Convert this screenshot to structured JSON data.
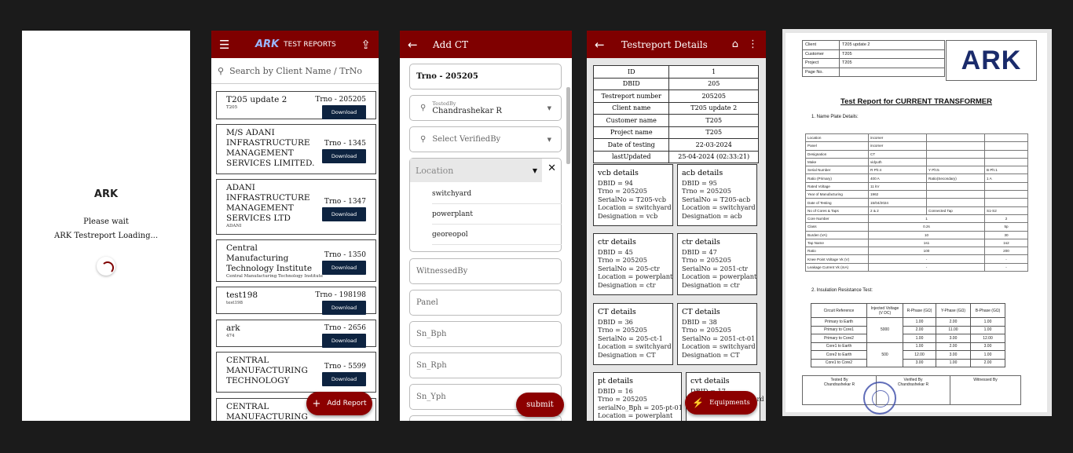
{
  "splash": {
    "logo": "ARK",
    "line1": "Please wait",
    "line2": "ARK Testreport Loading..."
  },
  "reports": {
    "menu_icon": "menu-icon",
    "logo": "ARK",
    "title": "TEST REPORTS",
    "upload_icon": "upload-icon",
    "search_placeholder": "Search by Client Name / TrNo",
    "download": "Download",
    "add": "Add Report",
    "items": [
      {
        "name": "T205 update 2",
        "client": "T205",
        "trno": "Trno - 205205"
      },
      {
        "name": "M/S ADANI INFRASTRUCTURE MANAGEMENT SERVICES LIMITED.",
        "client": "",
        "trno": "Trno - 1345"
      },
      {
        "name": "ADANI INFRASTRUCTURE MANAGEMENT SERVICES LTD",
        "client": "ADANI",
        "trno": "Trno - 1347"
      },
      {
        "name": "Central Manufacturing Technology Institute",
        "client": "Central Manufacturing Technology Institute",
        "trno": "Trno - 1350"
      },
      {
        "name": "test198",
        "client": "test198",
        "trno": "Trno - 198198"
      },
      {
        "name": "ark",
        "client": "474",
        "trno": "Trno - 2656"
      },
      {
        "name": "CENTRAL MANUFACTURING TECHNOLOGY",
        "client": "",
        "trno": "Trno - 5599"
      },
      {
        "name": "CENTRAL MANUFACTURING",
        "client": "",
        "trno": ""
      }
    ]
  },
  "addct": {
    "title": "Add CT",
    "trno": "Trno - 205205",
    "tested_by_label": "TestedBy",
    "tested_by": "Chandrashekar R",
    "verified_placeholder": "Select VerifiedBy",
    "location_placeholder": "Location",
    "locations": [
      "switchyard",
      "powerplant",
      "georeopol"
    ],
    "fields": [
      "WitnessedBy",
      "Panel",
      "Sn_Bph",
      "Sn_Rph",
      "Sn_Yph"
    ],
    "submit": "submit"
  },
  "details": {
    "title": "Testreport Details",
    "equipments": "Equipments",
    "rows": [
      [
        "ID",
        "1"
      ],
      [
        "DBID",
        "205"
      ],
      [
        "Testreport number",
        "205205"
      ],
      [
        "Client name",
        "T205 update 2"
      ],
      [
        "Customer name",
        "T205"
      ],
      [
        "Project name",
        "T205"
      ],
      [
        "Date of testing",
        "22-03-2024"
      ],
      [
        "lastUpdated",
        "25-04-2024 (02:33:21)"
      ]
    ],
    "cards": [
      {
        "title": "vcb details",
        "lines": [
          "DBID = 94",
          "Trno = 205205",
          "SerialNo = T205-vcb",
          "Location = switchyard",
          "Designation = vcb"
        ]
      },
      {
        "title": "acb details",
        "lines": [
          "DBID = 95",
          "Trno = 205205",
          "SerialNo = T205-acb",
          "Location = switchyard",
          "Designation = acb"
        ]
      },
      {
        "title": "ctr details",
        "lines": [
          "DBID = 45",
          "Trno = 205205",
          "SerialNo = 205-ctr",
          "Location = powerplant",
          "Designation = ctr"
        ]
      },
      {
        "title": "ctr details",
        "lines": [
          "DBID = 47",
          "Trno = 205205",
          "SerialNo = 2051-ctr",
          "Location = powerplant",
          "Designation = ctr"
        ]
      },
      {
        "title": "CT details",
        "lines": [
          "DBID = 36",
          "Trno = 205205",
          "SerialNo = 205-ct-1",
          "Location = switchyard",
          "Designation = CT"
        ]
      },
      {
        "title": "CT details",
        "lines": [
          "DBID = 38",
          "Trno = 205205",
          "SerialNo = 2051-ct-01",
          "Location = switchyard",
          "Designation = CT"
        ]
      },
      {
        "title": "pt details",
        "lines": [
          "DBID = 16",
          "Trno = 205205",
          "serialNo_Bph = 205-pt-01",
          "Location = powerplant"
        ]
      },
      {
        "title": "cvt details",
        "lines": [
          "DBID = 17",
          "",
          "",
          "Location = switchyard"
        ]
      }
    ]
  },
  "pdf": {
    "header": [
      [
        "Client",
        "T205 update 2"
      ],
      [
        "Customer",
        "T205"
      ],
      [
        "Project",
        "T205"
      ],
      [
        "Page No.",
        ""
      ]
    ],
    "logo": "ARK",
    "title": "Test Report for CURRENT TRANSFORMER",
    "sec1": "1. Name Plate Details:",
    "sec2": "2. Insulation Resistance Test:",
    "nameplate": [
      [
        "Location",
        "incomer",
        "",
        "",
        "",
        ""
      ],
      [
        "Panel",
        "incomer",
        "",
        "",
        "",
        ""
      ],
      [
        "Designation",
        "CT",
        "",
        "",
        "",
        ""
      ],
      [
        "Make",
        "vidyuth",
        "",
        "",
        "",
        ""
      ],
      [
        "Serial Number",
        "R Ph:4",
        "",
        "Y Ph:5",
        "B Ph:1",
        ""
      ],
      [
        "Ratio (Primary)",
        "400 A",
        "",
        "Ratio(Secondary)",
        "1 A",
        ""
      ],
      [
        "Rated Voltage",
        "11 kV",
        "",
        "",
        "",
        ""
      ],
      [
        "Year of Manufacturing",
        "1962",
        "",
        "",
        "",
        ""
      ],
      [
        "Date of Testing",
        "15/04/2024",
        "",
        "",
        "",
        ""
      ],
      [
        "No of Cores & Taps",
        "2 & 2",
        "",
        "Connected Tap",
        "S1-S2",
        ""
      ]
    ],
    "cores": [
      [
        "Core Number",
        "1",
        "2"
      ],
      [
        "Class",
        "0.2s",
        "5p"
      ],
      [
        "Burden (VA)",
        "10",
        "30"
      ],
      [
        "Tap Name",
        "1s1",
        "1s2"
      ],
      [
        "Ratio",
        "100",
        "200"
      ],
      [
        "Knee Point Voltage Vk (V)",
        "-",
        "-"
      ],
      [
        "Leakage Current Vk (mA)",
        "-",
        "-"
      ]
    ],
    "ir_head": [
      "Circuit Reference",
      "Injected Voltage (V DC)",
      "R-Phase (GΩ)",
      "Y-Phase (GΩ)",
      "B-Phase (GΩ)"
    ],
    "ir": [
      [
        "Primary to Earth",
        "1.00",
        "2.00",
        "1.00"
      ],
      [
        "Primary to Core1",
        "2.00",
        "11.00",
        "1.00"
      ],
      [
        "Primary to Core2",
        "1.00",
        "3.00",
        "12.00"
      ],
      [
        "Core1 to Earth",
        "1.00",
        "2.00",
        "3.00"
      ],
      [
        "Core2 to Earth",
        "12.00",
        "3.00",
        "1.00"
      ],
      [
        "Core1 to Core2",
        "3.00",
        "1.00",
        "2.00"
      ]
    ],
    "ir_v": [
      "5000",
      "500"
    ],
    "sign": {
      "tested_label": "Tested By",
      "tested": "Chandrashekar R",
      "verified_label": "Verified By",
      "verified": "Chandrashekar R",
      "witnessed_label": "Witnessed By"
    }
  }
}
